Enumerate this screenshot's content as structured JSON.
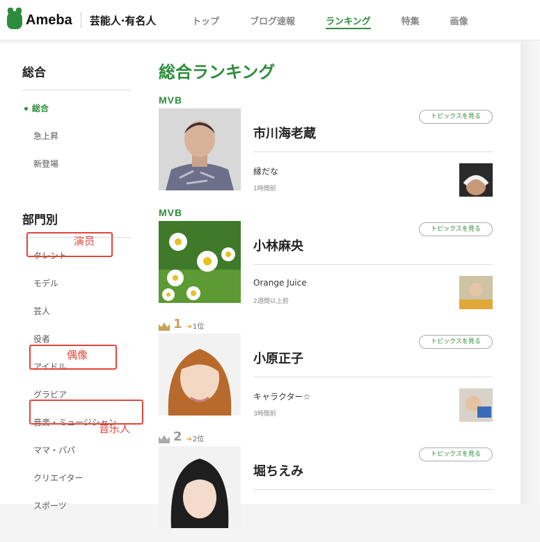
{
  "header": {
    "logo_text": "Ameba",
    "category": "芸能人·有名人",
    "nav": [
      "トップ",
      "ブログ速報",
      "ランキング",
      "特集",
      "画像"
    ]
  },
  "sidebar": {
    "heading_overall": "総合",
    "overall_items": [
      "総合",
      "急上昇",
      "新登場"
    ],
    "heading_division": "部門別",
    "division_items": [
      "タレント",
      "モデル",
      "芸人",
      "役者",
      "アイドル",
      "グラビア",
      "音楽・ミュージシャン",
      "ママ・パパ",
      "クリエイター",
      "スポーツ"
    ],
    "annotations": [
      "演员",
      "偶像",
      "音乐人"
    ]
  },
  "main": {
    "title": "総合ランキング",
    "topic_button": "トピックスを見る",
    "entries": [
      {
        "badge": "MVB",
        "name": "市川海老蔵",
        "entry": "縁だな",
        "time": "1時間前"
      },
      {
        "badge": "MVB",
        "name": "小林麻央",
        "entry": "Orange Juice",
        "time": "2週間以上前"
      },
      {
        "rank": "1",
        "up": "1位",
        "name": "小原正子",
        "entry": "キャラクター☆",
        "time": "3時間前"
      },
      {
        "rank": "2",
        "up": "2位",
        "name": "堀ちえみ",
        "entry": "",
        "time": ""
      }
    ]
  },
  "colors": {
    "accent": "#2d8c3c",
    "annotation": "#e0453b",
    "gold": "#c8a25a"
  }
}
